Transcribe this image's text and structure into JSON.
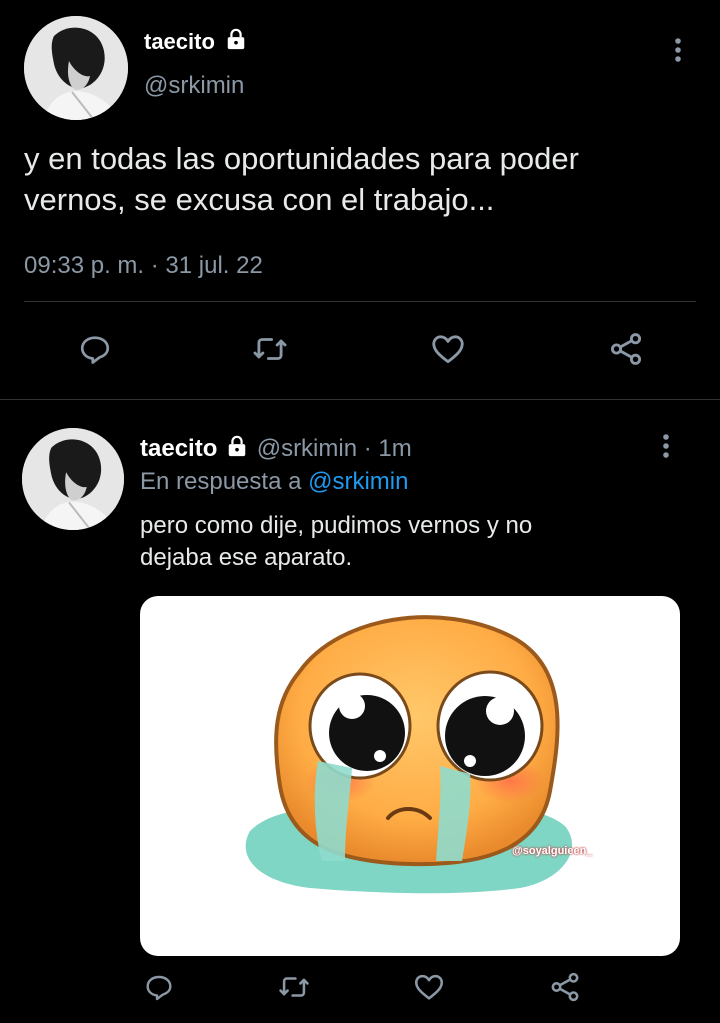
{
  "tweet": {
    "display_name": "taecito",
    "handle": "@srkimin",
    "text_line1": "y en todas las oportunidades para poder",
    "text_line2": "vernos, se excusa con el trabajo...",
    "timestamp": "09:33 p. m. · 31 jul. 22"
  },
  "reply": {
    "display_name": "taecito",
    "handle": "@srkimin",
    "separator": "·",
    "age": "1m",
    "in_reply_prefix": "En respuesta a",
    "in_reply_handle": "@srkimin",
    "text_line1": "pero como dije, pudimos vernos y no",
    "text_line2": "dejaba ese aparato.",
    "media_watermark": "@soyalguieen_"
  },
  "icons": {
    "lock": "lock-icon",
    "more": "more-vertical-icon",
    "reply": "reply-icon",
    "retweet": "retweet-icon",
    "like": "heart-icon",
    "share": "share-icon"
  },
  "colors": {
    "background": "#000000",
    "text": "#e7e9ea",
    "muted": "#8b98a5",
    "link": "#1d9bf0",
    "divider": "#2f3336"
  }
}
